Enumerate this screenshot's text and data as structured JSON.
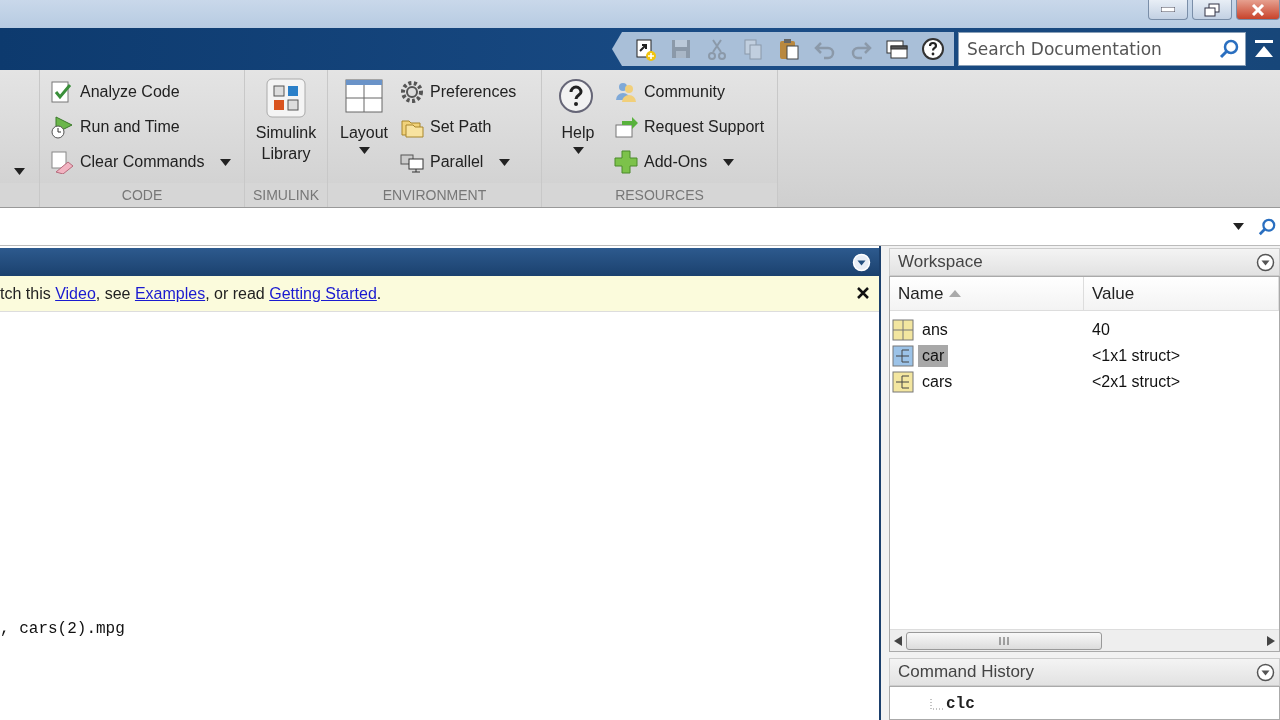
{
  "quick_access": {
    "buttons": [
      {
        "disabled": false
      },
      {
        "disabled": true
      },
      {
        "disabled": true
      },
      {
        "disabled": true
      },
      {
        "disabled": false
      },
      {
        "disabled": true
      },
      {
        "disabled": true
      },
      {
        "disabled": false
      },
      {
        "disabled": false
      }
    ],
    "search": {
      "placeholder": "Search Documentation"
    }
  },
  "ribbon": {
    "sections": [
      {
        "label": "CODE",
        "groups": [
          {
            "kind": "small",
            "items": [
              {
                "label": "Analyze Code",
                "dropdown": false
              },
              {
                "label": "Run and Time",
                "dropdown": false
              },
              {
                "label": "Clear Commands",
                "dropdown": true
              }
            ]
          }
        ]
      },
      {
        "label": "SIMULINK",
        "groups": [
          {
            "kind": "large",
            "items": [
              {
                "label": "Simulink Library",
                "dropdown": false
              }
            ]
          }
        ]
      },
      {
        "label": "ENVIRONMENT",
        "groups": [
          {
            "kind": "large",
            "items": [
              {
                "label": "Layout",
                "dropdown": true
              }
            ]
          },
          {
            "kind": "small",
            "items": [
              {
                "label": "Preferences",
                "dropdown": false
              },
              {
                "label": "Set Path",
                "dropdown": false
              },
              {
                "label": "Parallel",
                "dropdown": true
              }
            ]
          }
        ]
      },
      {
        "label": "RESOURCES",
        "groups": [
          {
            "kind": "large",
            "items": [
              {
                "label": "Help",
                "dropdown": true
              }
            ]
          },
          {
            "kind": "small",
            "items": [
              {
                "label": "Community",
                "dropdown": false
              },
              {
                "label": "Request Support",
                "dropdown": false
              },
              {
                "label": "Add-Ons",
                "dropdown": true
              }
            ]
          }
        ]
      }
    ]
  },
  "command_window": {
    "notice": {
      "parts": [
        {
          "kind": "text",
          "text": "tch this "
        },
        {
          "kind": "link",
          "text": "Video"
        },
        {
          "kind": "text",
          "text": ", see "
        },
        {
          "kind": "link",
          "text": "Examples"
        },
        {
          "kind": "text",
          "text": ", or read "
        },
        {
          "kind": "link",
          "text": "Getting Started"
        },
        {
          "kind": "text",
          "text": "."
        }
      ]
    },
    "lines": [
      ", cars(2).mpg"
    ]
  },
  "workspace": {
    "title": "Workspace",
    "columns": [
      {
        "label": "Name",
        "sorted": true
      },
      {
        "label": "Value",
        "sorted": false
      }
    ],
    "rows": [
      {
        "kind": "matrix",
        "name": "ans",
        "value": "40",
        "selected": false
      },
      {
        "kind": "struct",
        "name": "car",
        "value": "<1x1 struct>",
        "selected": true
      },
      {
        "kind": "struct",
        "name": "cars",
        "value": "<2x1 struct>",
        "selected": false
      }
    ]
  },
  "command_history": {
    "title": "Command History",
    "items": [
      {
        "text": "clc"
      }
    ]
  }
}
